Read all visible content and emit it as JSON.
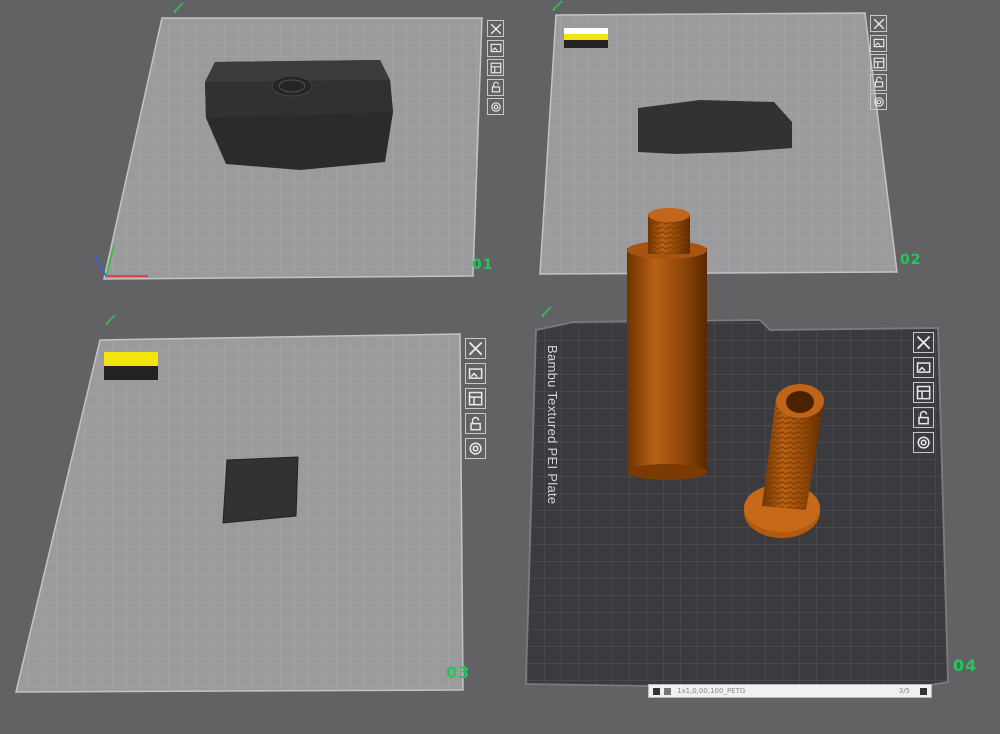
{
  "plates": [
    {
      "number": "01"
    },
    {
      "number": "02"
    },
    {
      "number": "03"
    },
    {
      "number": "04",
      "bed_label": "Bambu Textured PEI Plate"
    }
  ],
  "plate_tools": [
    "close-icon",
    "image-icon",
    "arrange-icon",
    "lock-icon",
    "settings-icon"
  ],
  "filament_swatches": {
    "top": "#ffffff",
    "mid": "#f2e40c",
    "bottom": "#222222"
  },
  "bottom_bar": {
    "left_text": "1x1,0,00,100_PETG",
    "right_text": "3/5"
  },
  "colors": {
    "background": "#626264",
    "plate_grey": "#9a9a9c",
    "plate_textured": "#3a3a3e",
    "model_dark": "#2e2e30",
    "model_orange": "#b45a0e",
    "plate_number": "#1ec85a"
  }
}
